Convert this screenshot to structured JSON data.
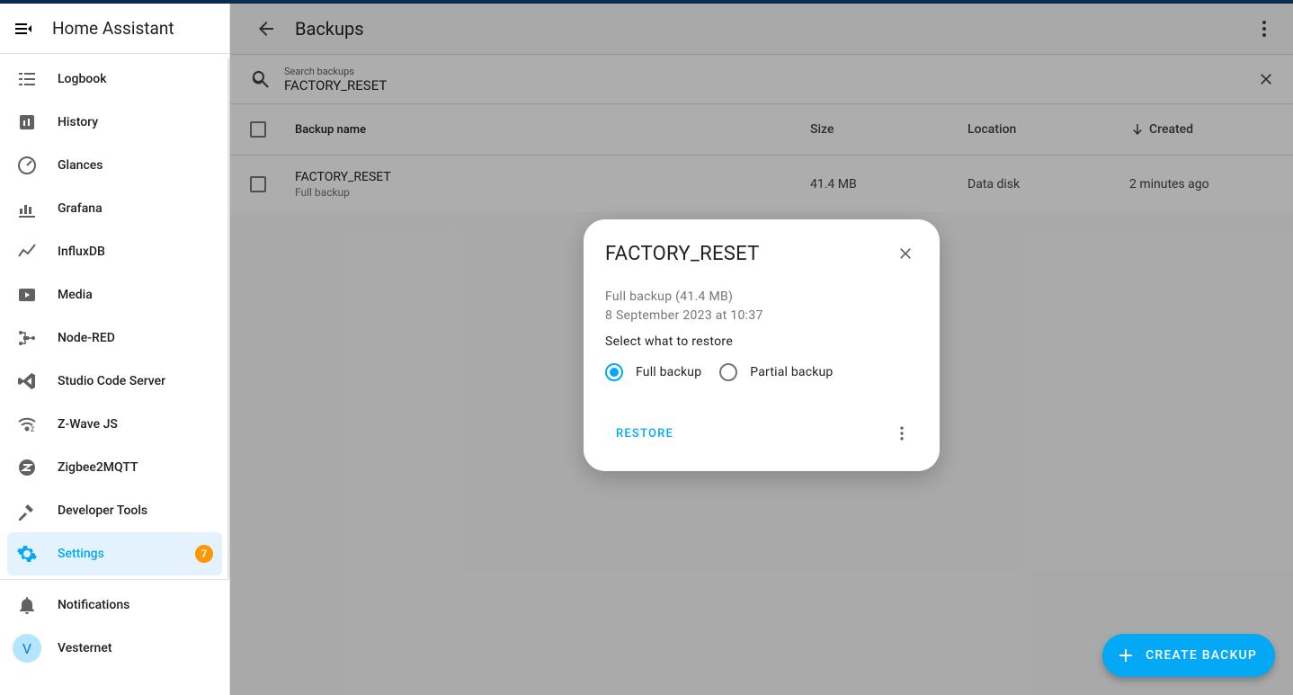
{
  "app_title": "Home Assistant",
  "sidebar_groups": {
    "main": [
      {
        "label": "Logbook",
        "icon": "logbook-icon"
      },
      {
        "label": "History",
        "icon": "history-icon"
      },
      {
        "label": "Glances",
        "icon": "gauge-icon"
      },
      {
        "label": "Grafana",
        "icon": "grafana-icon"
      },
      {
        "label": "InfluxDB",
        "icon": "influxdb-icon"
      },
      {
        "label": "Media",
        "icon": "media-icon"
      },
      {
        "label": "Node-RED",
        "icon": "nodered-icon"
      },
      {
        "label": "Studio Code Server",
        "icon": "vscode-icon"
      },
      {
        "label": "Z-Wave JS",
        "icon": "zwave-icon"
      },
      {
        "label": "Zigbee2MQTT",
        "icon": "zigbee-icon"
      },
      {
        "label": "Developer Tools",
        "icon": "hammer-icon"
      },
      {
        "label": "Settings",
        "icon": "gear-icon",
        "badge": "7",
        "active": true
      }
    ],
    "footer": [
      {
        "label": "Notifications",
        "icon": "bell-icon"
      },
      {
        "label": "Vesternet",
        "avatar_initial": "V"
      }
    ]
  },
  "page": {
    "title": "Backups",
    "search": {
      "label": "Search backups",
      "value": "FACTORY_RESET"
    },
    "table_headers": {
      "name": "Backup name",
      "size": "Size",
      "location": "Location",
      "created": "Created"
    },
    "rows": [
      {
        "name": "FACTORY_RESET",
        "sub": "Full backup",
        "size": "41.4 MB",
        "location": "Data disk",
        "created": "2 minutes ago"
      }
    ],
    "fab_label": "CREATE BACKUP"
  },
  "dialog": {
    "title": "FACTORY_RESET",
    "meta_line1": "Full backup (41.4 MB)",
    "meta_line2": "8 September 2023 at 10:37",
    "section_title": "Select what to restore",
    "option_full": "Full backup",
    "option_partial": "Partial backup",
    "restore_label": "RESTORE"
  }
}
